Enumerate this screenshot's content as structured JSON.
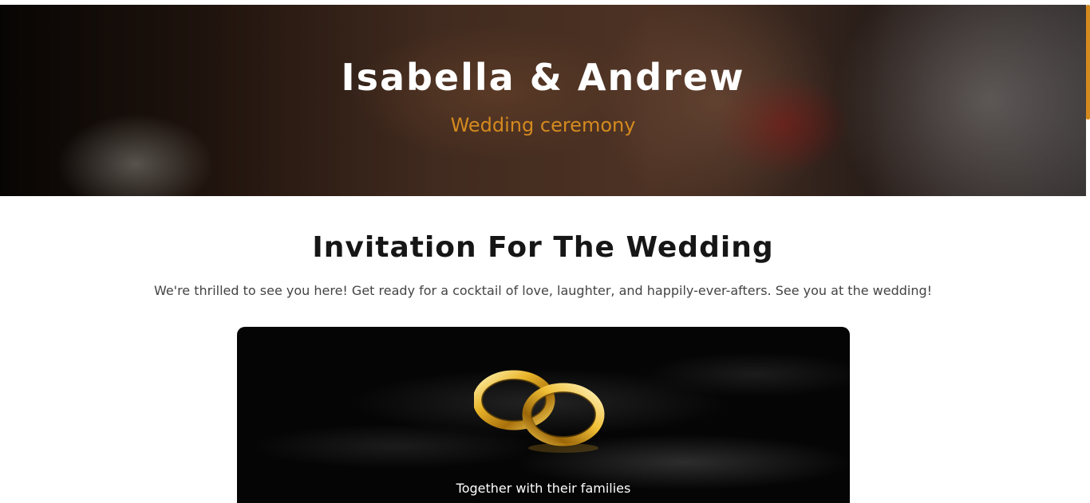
{
  "hero": {
    "title": "Isabella & Andrew",
    "subtitle": "Wedding ceremony",
    "image_icon": "wedding-hands-photo"
  },
  "invitation": {
    "title": "Invitation For The Wedding",
    "text": "We're thrilled to see you here! Get ready for a cocktail of love, laughter, and happily-ever-afters. See you at the wedding!"
  },
  "card": {
    "image_icon": "gold-rings-icon",
    "text": "Together with their families"
  },
  "colors": {
    "accent": "#d48a1e",
    "heading": "#161616",
    "body_text": "#444444",
    "card_background": "#050505"
  }
}
